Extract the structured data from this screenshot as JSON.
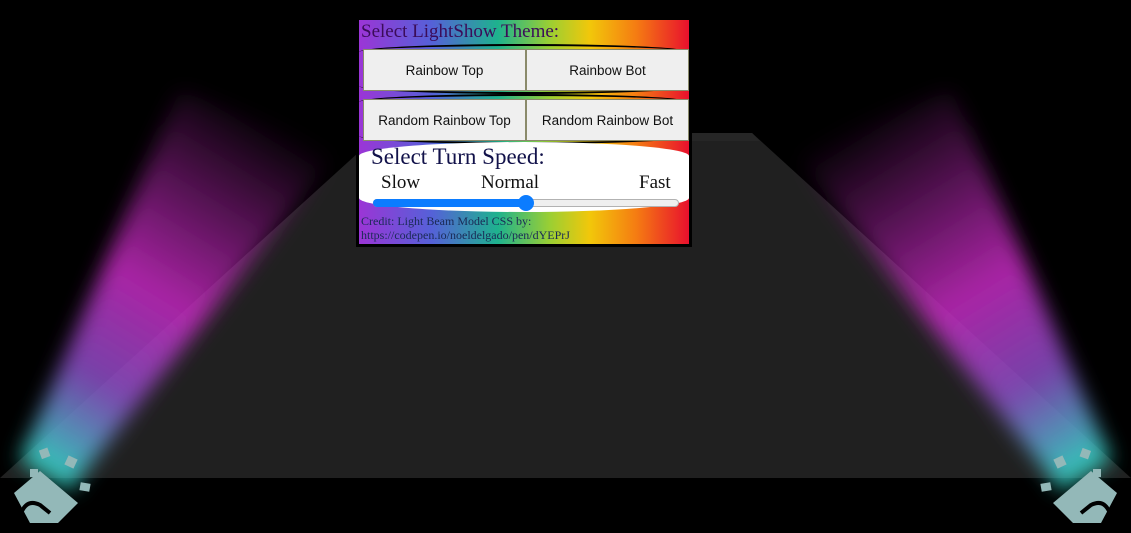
{
  "panel": {
    "title": "Select LightShow Theme:",
    "buttons": [
      {
        "label": "Rainbow Top"
      },
      {
        "label": "Rainbow Bot"
      },
      {
        "label": "Random Rainbow Top"
      },
      {
        "label": "Random Rainbow Bot"
      }
    ]
  },
  "speed": {
    "title": "Select Turn Speed:",
    "labels": {
      "slow": "Slow",
      "normal": "Normal",
      "fast": "Fast"
    },
    "value": 0.5
  },
  "credit": {
    "line1": "Credit: Light Beam Model CSS by:",
    "line2": "https://codepen.io/noeldelgado/pen/dYEPrJ"
  },
  "colors": {
    "beam": "#c72bc2",
    "beam_base": "#2fd4c1",
    "lamp": "#93b8b8",
    "floor": "#1f1f1f",
    "slider": "#0b7cff"
  },
  "icons": [
    "spotlight-icon",
    "spotlight-icon"
  ]
}
